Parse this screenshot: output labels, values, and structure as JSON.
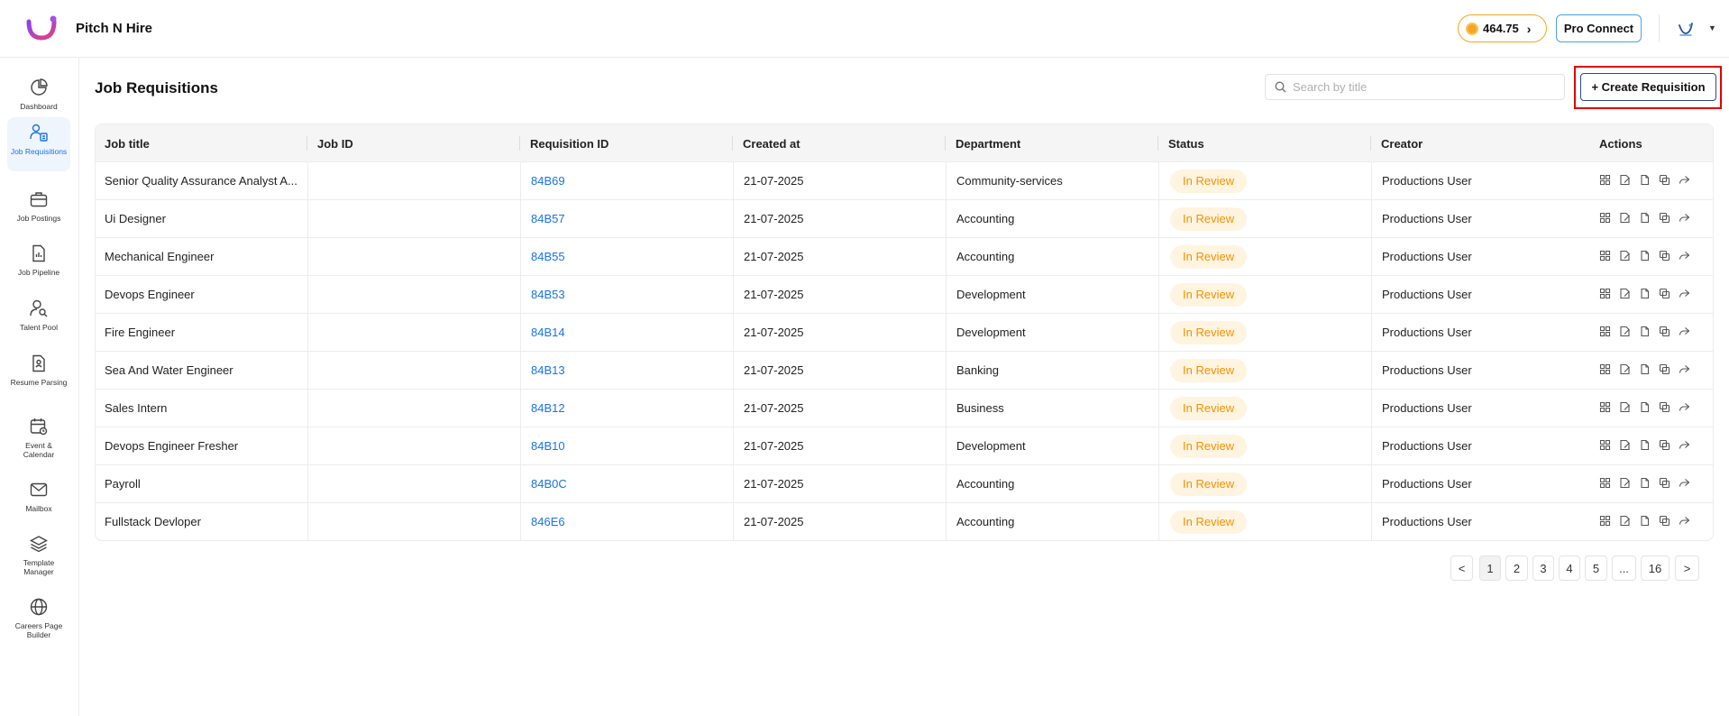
{
  "header": {
    "app_name": "Pitch N Hire",
    "coins": "464.75",
    "pro_connect": "Pro Connect"
  },
  "sidebar": {
    "items": [
      {
        "label": "Dashboard"
      },
      {
        "label": "Job Requisitions",
        "active": true
      },
      {
        "label": "Job Postings"
      },
      {
        "label": "Job Pipeline"
      },
      {
        "label": "Talent Pool"
      },
      {
        "label": "Resume Parsing"
      },
      {
        "label": "Event & Calendar"
      },
      {
        "label": "Mailbox"
      },
      {
        "label": "Template Manager"
      },
      {
        "label": "Careers Page Builder"
      }
    ]
  },
  "main": {
    "title": "Job Requisitions",
    "search_placeholder": "Search by title",
    "create_label": "+ Create Requisition"
  },
  "table": {
    "columns": [
      "Job title",
      "Job ID",
      "Requisition ID",
      "Created at",
      "Department",
      "Status",
      "Creator",
      "Actions"
    ],
    "rows": [
      {
        "title": "Senior Quality Assurance Analyst A...",
        "job_id": "",
        "req_id": "84B69",
        "created": "21-07-2025",
        "dept": "Community-services",
        "status": "In Review",
        "creator": "Productions User"
      },
      {
        "title": "Ui Designer",
        "job_id": "",
        "req_id": "84B57",
        "created": "21-07-2025",
        "dept": "Accounting",
        "status": "In Review",
        "creator": "Productions User"
      },
      {
        "title": "Mechanical Engineer",
        "job_id": "",
        "req_id": "84B55",
        "created": "21-07-2025",
        "dept": "Accounting",
        "status": "In Review",
        "creator": "Productions User"
      },
      {
        "title": "Devops Engineer",
        "job_id": "",
        "req_id": "84B53",
        "created": "21-07-2025",
        "dept": "Development",
        "status": "In Review",
        "creator": "Productions User"
      },
      {
        "title": "Fire Engineer",
        "job_id": "",
        "req_id": "84B14",
        "created": "21-07-2025",
        "dept": "Development",
        "status": "In Review",
        "creator": "Productions User"
      },
      {
        "title": "Sea And Water Engineer",
        "job_id": "",
        "req_id": "84B13",
        "created": "21-07-2025",
        "dept": "Banking",
        "status": "In Review",
        "creator": "Productions User"
      },
      {
        "title": "Sales Intern",
        "job_id": "",
        "req_id": "84B12",
        "created": "21-07-2025",
        "dept": "Business",
        "status": "In Review",
        "creator": "Productions User"
      },
      {
        "title": "Devops Engineer Fresher",
        "job_id": "",
        "req_id": "84B10",
        "created": "21-07-2025",
        "dept": "Development",
        "status": "In Review",
        "creator": "Productions User"
      },
      {
        "title": "Payroll",
        "job_id": "",
        "req_id": "84B0C",
        "created": "21-07-2025",
        "dept": "Accounting",
        "status": "In Review",
        "creator": "Productions User"
      },
      {
        "title": "Fullstack Devloper",
        "job_id": "",
        "req_id": "846E6",
        "created": "21-07-2025",
        "dept": "Accounting",
        "status": "In Review",
        "creator": "Productions User"
      }
    ],
    "action_icons": [
      "view-icon",
      "edit-icon",
      "copy-icon",
      "duplicate-icon",
      "share-icon"
    ]
  },
  "pagination": {
    "prev": "<",
    "pages": [
      "1",
      "2",
      "3",
      "4",
      "5",
      "...",
      "16"
    ],
    "current": "1",
    "next": ">"
  },
  "colors": {
    "accent": "#1a73e8",
    "status_bg": "#fff4e0",
    "status_text": "#f39200",
    "highlight_border": "#e00000"
  }
}
